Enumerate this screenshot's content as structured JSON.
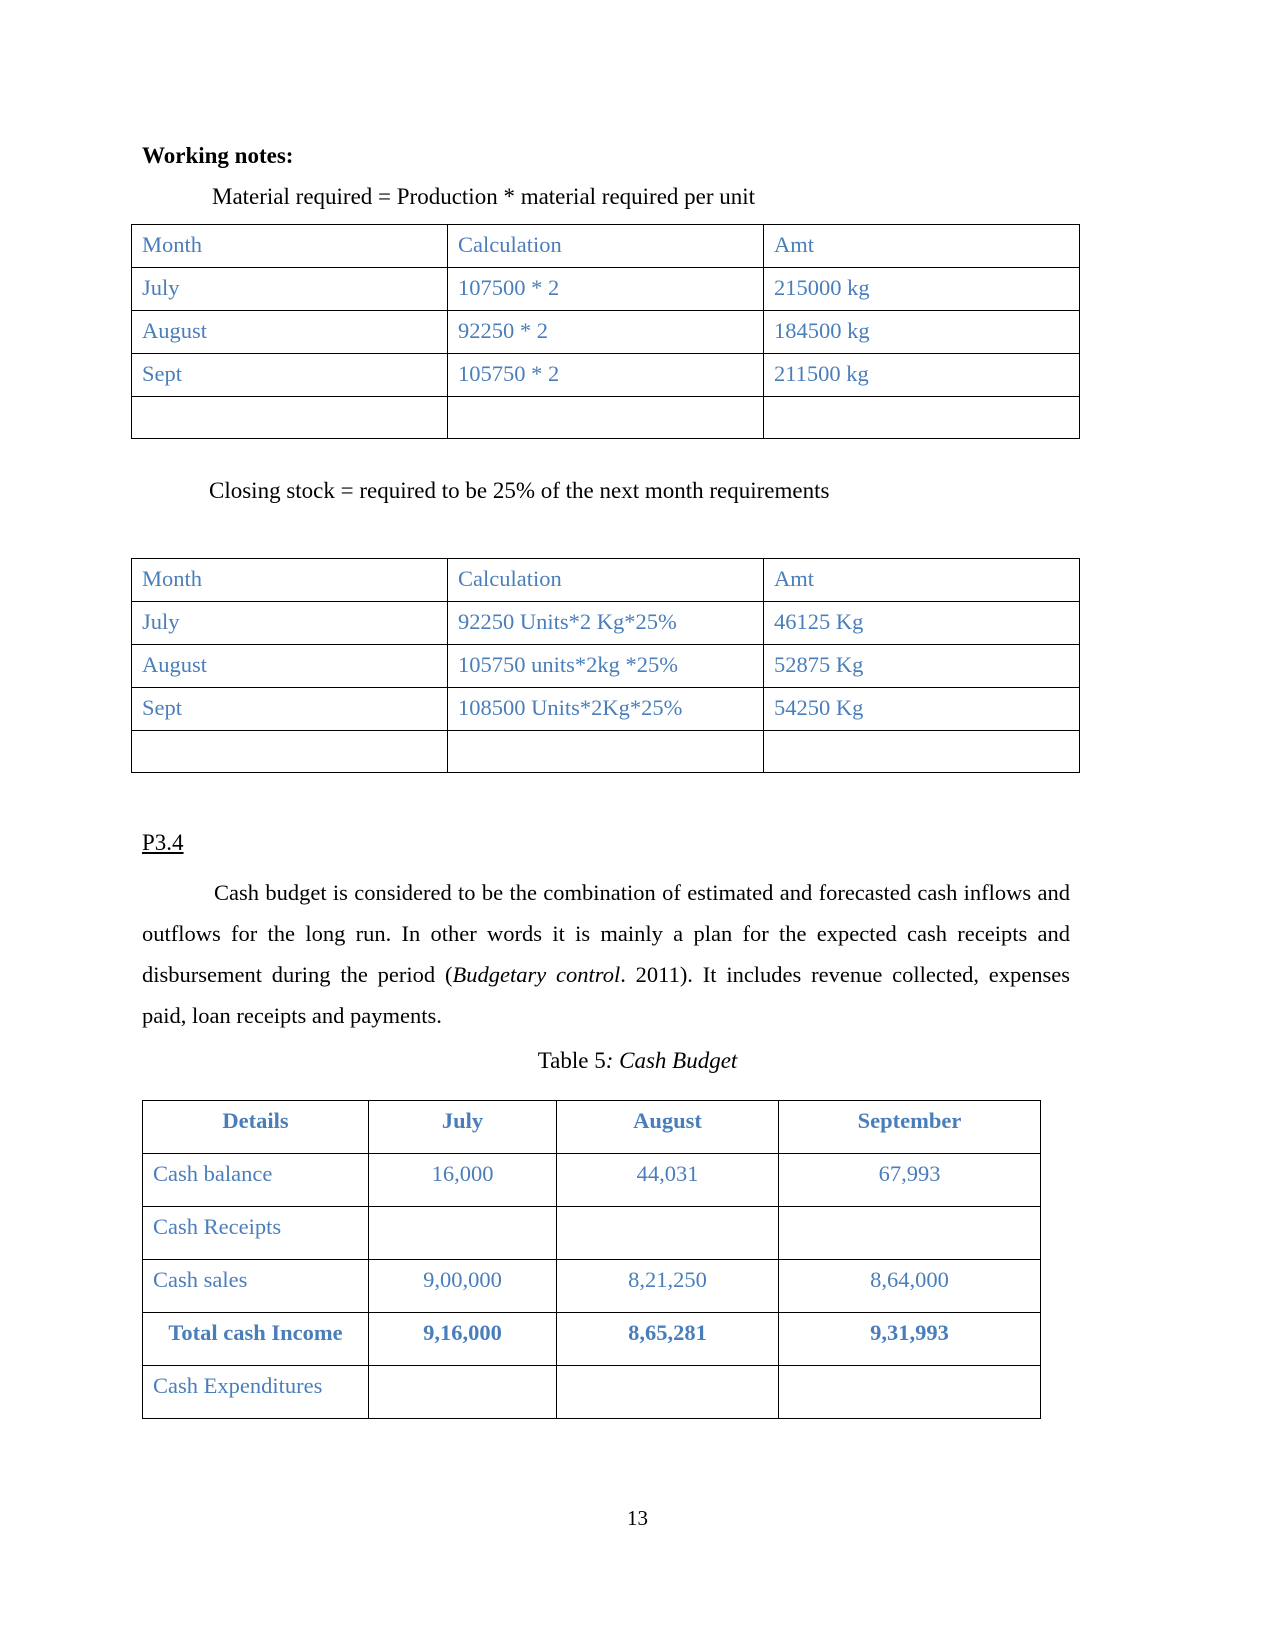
{
  "document": {
    "page_number": "13",
    "accent_color": "#4a7ebb",
    "text_color": "#000000"
  },
  "working_notes": {
    "heading": "Working notes:",
    "formula_material": "Material required = Production * material required per unit",
    "formula_closing_stock": "Closing stock = required to be 25% of the next month requirements"
  },
  "material_table": {
    "columns": [
      "Month",
      "Calculation",
      "Amt"
    ],
    "rows": [
      [
        "July",
        "107500 * 2",
        "215000 kg"
      ],
      [
        "August",
        "92250 * 2",
        "184500 kg"
      ],
      [
        "Sept",
        "105750 * 2",
        "211500 kg"
      ],
      [
        "",
        "",
        ""
      ]
    ]
  },
  "closing_stock_table": {
    "columns": [
      "Month",
      "Calculation",
      "Amt"
    ],
    "rows": [
      [
        "July",
        "92250 Units*2 Kg*25%",
        "46125 Kg"
      ],
      [
        "August",
        "105750 units*2kg *25%",
        "52875 Kg"
      ],
      [
        "Sept",
        "108500 Units*2Kg*25%",
        "54250 Kg"
      ],
      [
        "",
        "",
        ""
      ]
    ]
  },
  "section": {
    "label": "P3.4",
    "paragraph_part1": "Cash budget is considered to be the combination of estimated and forecasted cash inflows and outflows for the long run. In other words it is mainly a plan for the expected cash receipts and disbursement during the period (",
    "paragraph_citation": "Budgetary control",
    "paragraph_part2": ". 2011). It includes revenue collected, expenses paid, loan receipts and payments."
  },
  "cash_budget": {
    "caption_prefix": "Table 5",
    "caption_title": ": Cash Budget",
    "columns": [
      "Details",
      "July",
      "August",
      "September"
    ],
    "rows": [
      {
        "label": "Cash balance",
        "bold": false,
        "values": [
          "16,000",
          "44,031",
          "67,993"
        ]
      },
      {
        "label": "Cash Receipts",
        "bold": false,
        "values": [
          "",
          "",
          ""
        ]
      },
      {
        "label": "Cash sales",
        "bold": false,
        "values": [
          "9,00,000",
          "8,21,250",
          "8,64,000"
        ]
      },
      {
        "label": "Total cash Income",
        "bold": true,
        "values": [
          "9,16,000",
          "8,65,281",
          "9,31,993"
        ]
      },
      {
        "label": "Cash Expenditures",
        "bold": false,
        "values": [
          "",
          "",
          ""
        ]
      }
    ]
  }
}
